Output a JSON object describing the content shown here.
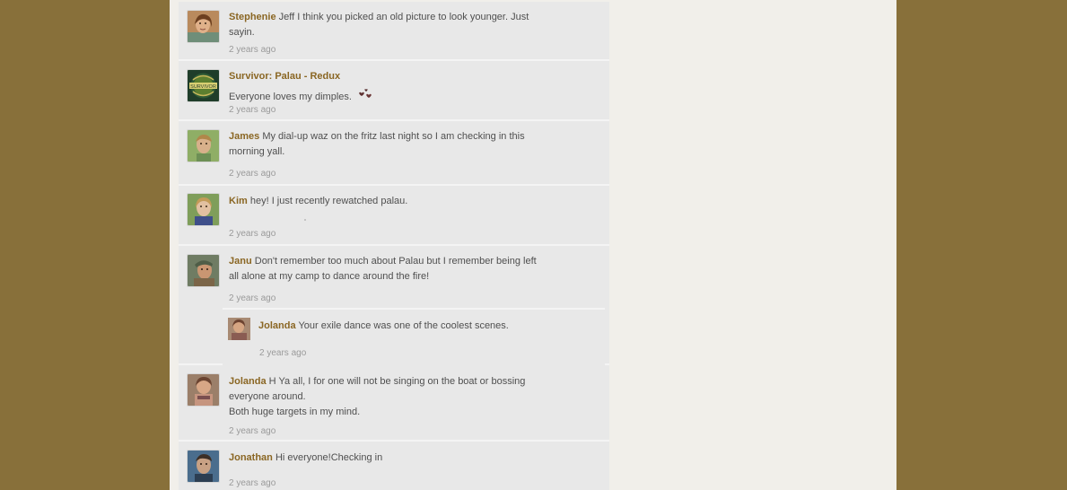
{
  "feed": {
    "posts": [
      {
        "author": "Stephenie",
        "text": "Jeff I think you picked an old picture to look younger. Just sayin.",
        "time": "2 years ago",
        "avatar_icon": "stephenie-avatar-icon"
      },
      {
        "author": "Survivor: Palau - Redux",
        "text": "Everyone loves my dimples.",
        "time": "2 years ago",
        "avatar_icon": "survivor-logo-icon",
        "emoji_icon": "hearts-emoji-icon"
      },
      {
        "author": "James",
        "text": "My dial-up waz on the fritz last night so I am checking in this morning yall.",
        "time": "2 years ago",
        "avatar_icon": "james-avatar-icon"
      },
      {
        "author": "Kim",
        "text": "hey! I just recently rewatched palau.",
        "time": "2 years ago",
        "avatar_icon": "kim-avatar-icon"
      },
      {
        "author": "Janu",
        "text": "Don't remember too much about Palau but I remember being left all alone at my camp to dance around the fire!",
        "time": "2 years ago",
        "avatar_icon": "janu-avatar-icon",
        "reply": {
          "author": "Jolanda",
          "text": "Your exile dance was one of the coolest scenes.",
          "time": "2 years ago",
          "avatar_icon": "jolanda-reply-avatar-icon"
        }
      },
      {
        "author": "Jolanda",
        "text": "H Ya all, I for one will not be singing on the boat or bossing everyone around.",
        "text2": "Both huge targets in my mind.",
        "time": "2 years ago",
        "avatar_icon": "jolanda-avatar-icon"
      },
      {
        "author": "Jonathan",
        "text": "Hi everyone!Checking in",
        "time": "2 years ago",
        "avatar_icon": "jonathan-avatar-icon"
      }
    ]
  },
  "colors": {
    "background": "#88703a",
    "panel": "#f1efea",
    "post": "#e8e8e8",
    "author": "#8a6623",
    "time": "#9a9a9a"
  }
}
